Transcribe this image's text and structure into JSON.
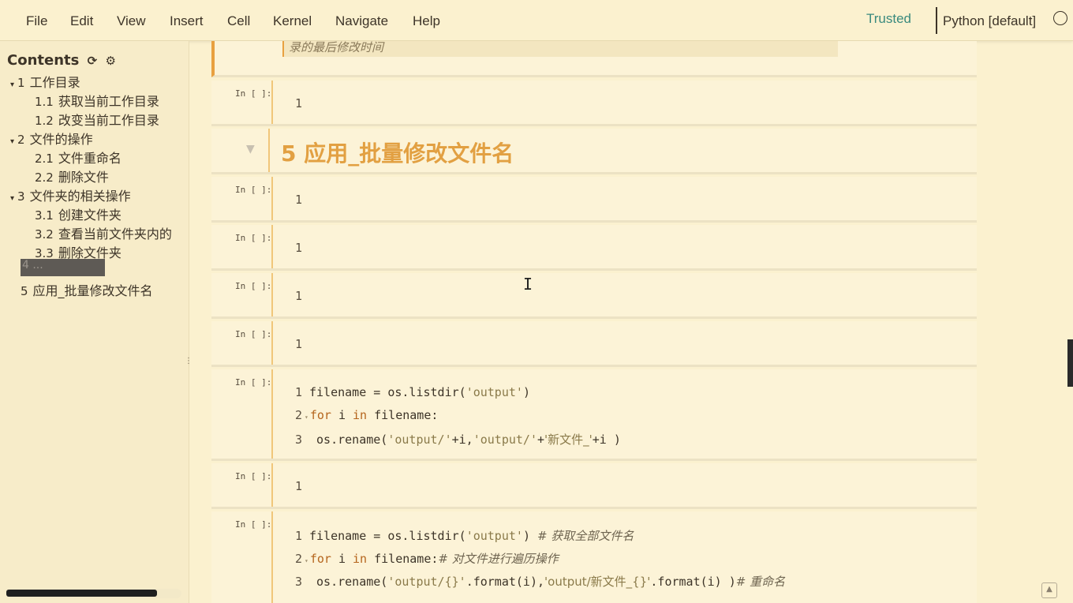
{
  "menu": [
    "File",
    "Edit",
    "View",
    "Insert",
    "Cell",
    "Kernel",
    "Navigate",
    "Help"
  ],
  "trusted": "Trusted",
  "kernel": "Python [default]",
  "toc": {
    "title": "Contents",
    "items": [
      {
        "num": "1",
        "label": "工作目录",
        "caret": "▾"
      },
      {
        "num": "1.1",
        "label": "获取当前工作目录",
        "caret": ""
      },
      {
        "num": "1.2",
        "label": "改变当前工作目录",
        "caret": ""
      },
      {
        "num": "2",
        "label": "文件的操作",
        "caret": "▾"
      },
      {
        "num": "2.1",
        "label": "文件重命名",
        "caret": ""
      },
      {
        "num": "2.2",
        "label": "删除文件",
        "caret": ""
      },
      {
        "num": "3",
        "label": "文件夹的相关操作",
        "caret": "▾"
      },
      {
        "num": "3.1",
        "label": "创建文件夹",
        "caret": ""
      },
      {
        "num": "3.2",
        "label": "查看当前文件夹内的",
        "caret": ""
      },
      {
        "num": "3.3",
        "label": "删除文件夹",
        "caret": ""
      },
      {
        "num": "5",
        "label": "应用_批量修改文件名",
        "caret": ""
      }
    ],
    "highlight_label": "4 ..."
  },
  "top_quote": "录的最后修改时间",
  "prompt": "In [ ]:",
  "heading": "5  应用_批量修改文件名",
  "cells": {
    "c1": [
      "1"
    ],
    "c3": [
      "1"
    ],
    "c4": [
      "1"
    ],
    "c5": [
      "1"
    ],
    "c6": [
      "1"
    ],
    "c8": [
      "1"
    ]
  },
  "code7": {
    "l1": {
      "n": "1",
      "a": "filename = os.listdir(",
      "s": "'output'",
      "b": ")"
    },
    "l2": {
      "n": "2",
      "kw1": "for",
      "a": " i ",
      "kw2": "in",
      "b": " filename:"
    },
    "l3": {
      "n": "3",
      "a": "    os.rename(",
      "s1": "'output/'",
      "b": "+i,",
      "s2": "'output/'",
      "c": "+",
      "s3": "'新文件_'",
      "d": "+i )"
    }
  },
  "code9": {
    "l1": {
      "n": "1",
      "a": "filename = os.listdir(",
      "s": "'output'",
      "b": ") ",
      "cm": "# 获取全部文件名"
    },
    "l2": {
      "n": "2",
      "kw1": "for",
      "a": " i ",
      "kw2": "in",
      "b": " filename:",
      "cm": "# 对文件进行遍历操作"
    },
    "l3": {
      "n": "3",
      "a": "    os.rename(",
      "s1": "'output/{}'",
      "b": ".format(i),",
      "s2": "'output/新文件_{}'",
      "c": ".format(i) )",
      "cm": "# 重命名"
    }
  }
}
